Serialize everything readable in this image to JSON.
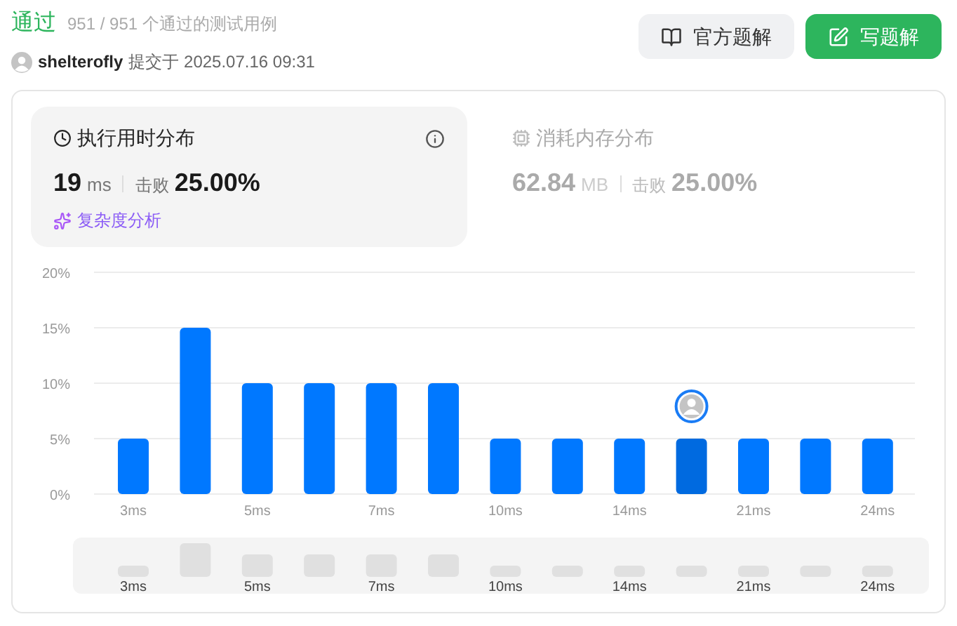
{
  "header": {
    "status": "通过",
    "cases": "951 / 951 个通过的测试用例",
    "user": "shelterofly",
    "submitted": "提交于 2025.07.16 09:31",
    "buttons": [
      {
        "kind": "solution",
        "label": "官方题解"
      },
      {
        "kind": "write",
        "label": "写题解"
      }
    ]
  },
  "stats": [
    {
      "kind": "runtime",
      "selected": true,
      "title": "执行用时分布",
      "value": "19",
      "unit": "ms",
      "beat_label": "击败",
      "beat": "25.00%",
      "link": "复杂度分析"
    },
    {
      "kind": "memory",
      "selected": false,
      "title": "消耗内存分布",
      "value": "62.84",
      "unit": "MB",
      "beat_label": "击败",
      "beat": "25.00%"
    }
  ],
  "chart_data": {
    "type": "bar",
    "categories": [
      "3ms",
      null,
      "5ms",
      null,
      "7ms",
      null,
      "10ms",
      null,
      "14ms",
      null,
      "21ms",
      null,
      "24ms"
    ],
    "values": [
      5,
      15,
      10,
      10,
      10,
      10,
      5,
      5,
      5,
      5,
      5,
      5,
      5
    ],
    "ylim": [
      0,
      20
    ],
    "yticks": [
      {
        "value": 0,
        "label": "0%"
      },
      {
        "value": 5,
        "label": "5%"
      },
      {
        "value": 10,
        "label": "10%"
      },
      {
        "value": 15,
        "label": "15%"
      },
      {
        "value": 20,
        "label": "20%"
      }
    ],
    "grid": true
  },
  "chart_bars": [
    {
      "selected": false
    },
    {
      "selected": false
    },
    {
      "selected": false
    },
    {
      "selected": false
    },
    {
      "selected": false
    },
    {
      "selected": false
    },
    {
      "selected": false
    },
    {
      "selected": false
    },
    {
      "selected": false
    },
    {
      "selected": true
    },
    {
      "selected": false
    },
    {
      "selected": false
    },
    {
      "selected": false
    }
  ],
  "overview": {
    "labels": [
      "3ms",
      "5ms",
      "7ms",
      "10ms",
      "14ms",
      "21ms",
      "24ms"
    ]
  }
}
